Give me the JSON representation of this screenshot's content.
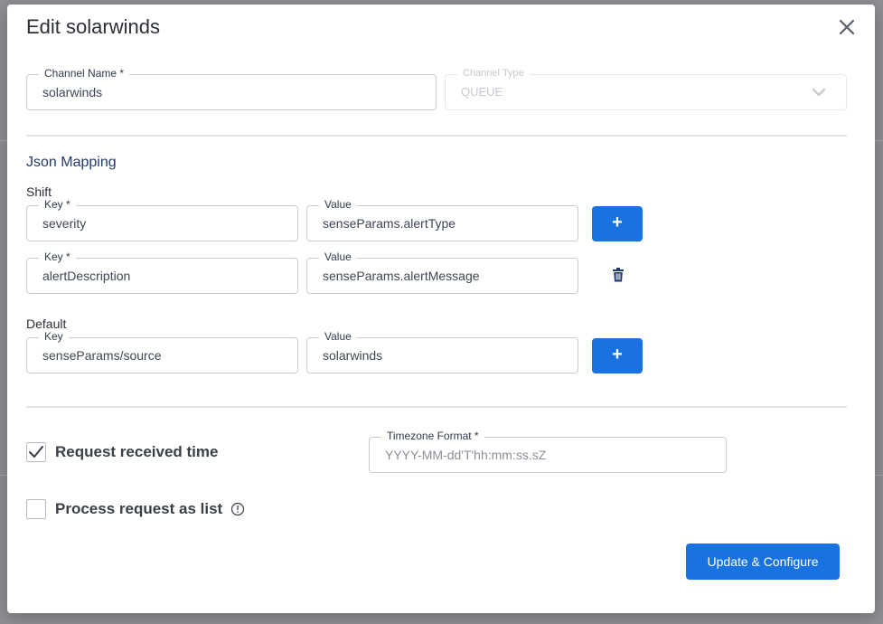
{
  "dialog": {
    "title": "Edit solarwinds",
    "close_icon": "close-icon"
  },
  "channel": {
    "name_label": "Channel Name *",
    "name_value": "solarwinds",
    "type_label": "Channel Type",
    "type_value": "QUEUE"
  },
  "json_mapping": {
    "title": "Json Mapping",
    "shift": {
      "label": "Shift",
      "rows": [
        {
          "key_label": "Key *",
          "key": "severity",
          "value_label": "Value",
          "value": "senseParams.alertType"
        },
        {
          "key_label": "Key *",
          "key": "alertDescription",
          "value_label": "Value",
          "value": "senseParams.alertMessage"
        }
      ]
    },
    "default": {
      "label": "Default",
      "rows": [
        {
          "key_label": "Key",
          "key": "senseParams/source",
          "value_label": "Value",
          "value": "solarwinds"
        }
      ]
    },
    "add_symbol": "+"
  },
  "options": {
    "request_time_label": "Request received time",
    "request_time_checked": true,
    "timezone_label": "Timezone Format *",
    "timezone_placeholder": "YYYY-MM-dd'T'hh:mm:ss.sZ",
    "process_list_label": "Process request as list",
    "process_list_checked": false
  },
  "actions": {
    "submit_label": "Update & Configure"
  },
  "colors": {
    "primary": "#1872e0",
    "section_title": "#233a6b",
    "overlay": "#8d8f93"
  }
}
